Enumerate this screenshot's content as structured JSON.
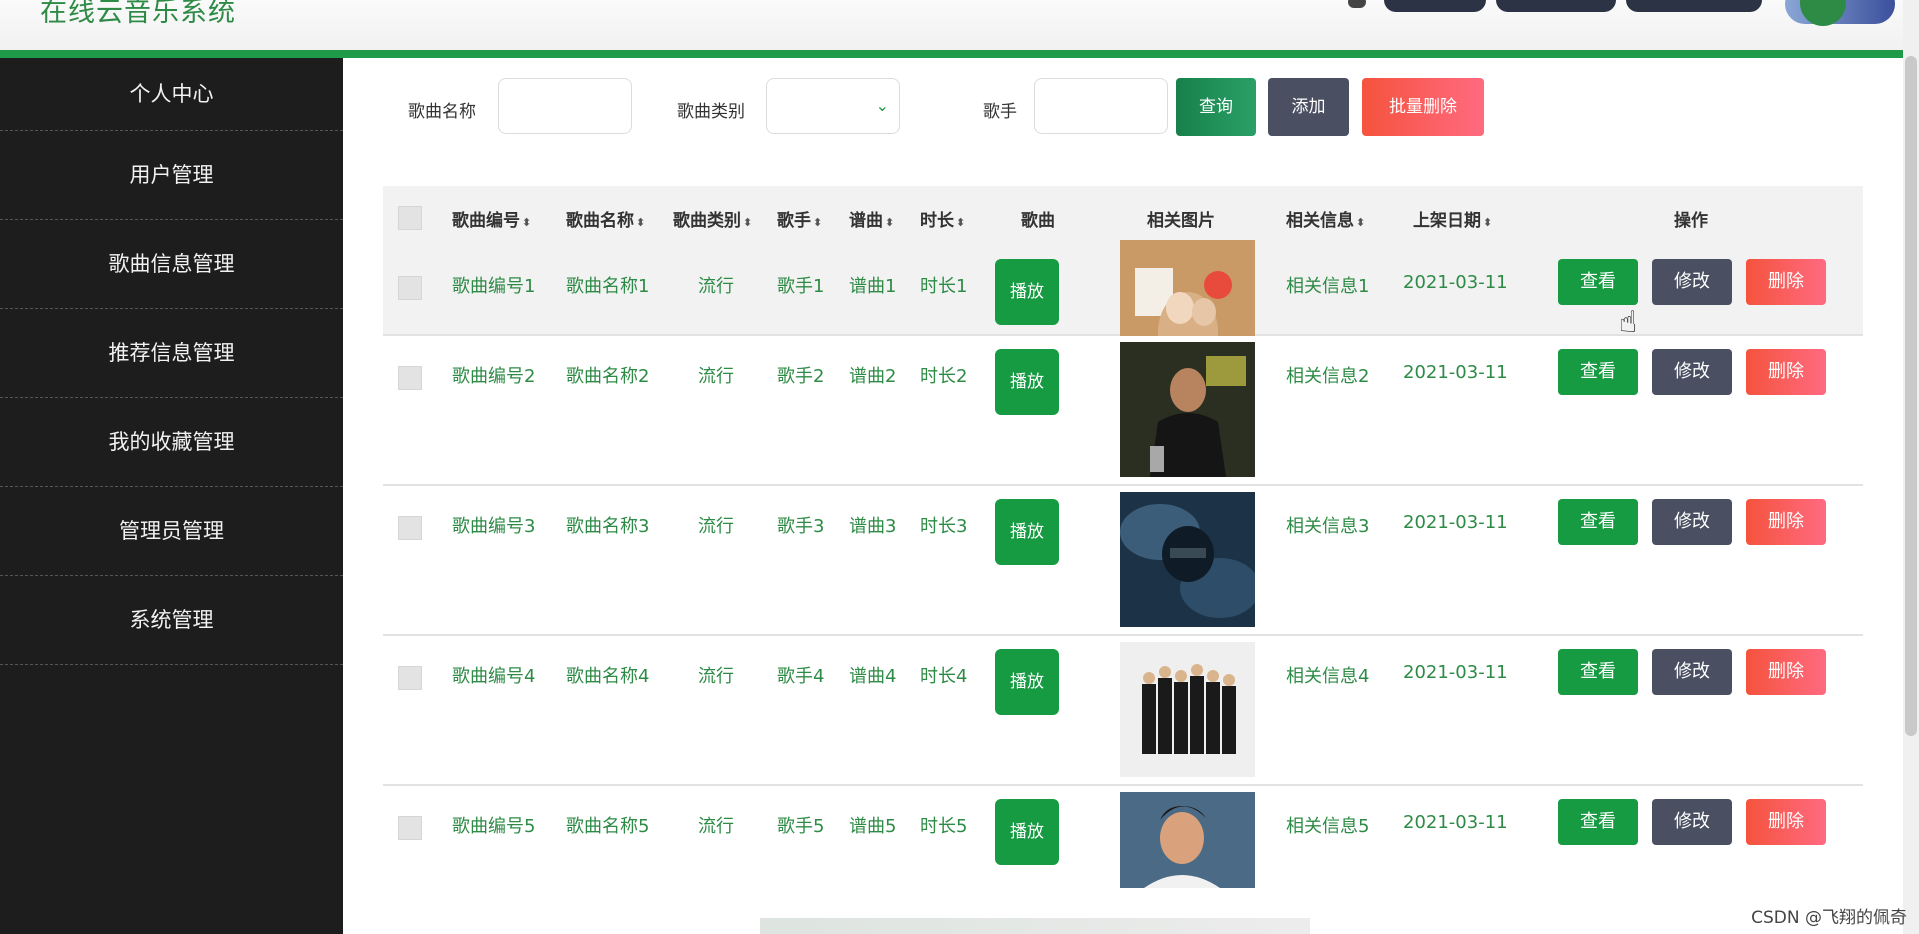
{
  "header": {
    "app_title": "在线云音乐系统"
  },
  "sidebar": {
    "items": [
      {
        "label": "个人中心"
      },
      {
        "label": "用户管理"
      },
      {
        "label": "歌曲信息管理"
      },
      {
        "label": "推荐信息管理"
      },
      {
        "label": "我的收藏管理"
      },
      {
        "label": "管理员管理"
      },
      {
        "label": "系统管理"
      }
    ]
  },
  "search": {
    "song_name_label": "歌曲名称",
    "song_type_label": "歌曲类别",
    "singer_label": "歌手",
    "query_button": "查询",
    "add_button": "添加",
    "batch_delete_button": "批量删除"
  },
  "table": {
    "columns": [
      "歌曲编号",
      "歌曲名称",
      "歌曲类别",
      "歌手",
      "谱曲",
      "时长",
      "歌曲",
      "相关图片",
      "相关信息",
      "上架日期",
      "操作"
    ],
    "sort_icon": "⬍",
    "play_label": "播放",
    "view_label": "查看",
    "edit_label": "修改",
    "delete_label": "删除",
    "rows": [
      {
        "id": "歌曲编号1",
        "name": "歌曲名称1",
        "type": "流行",
        "singer": "歌手1",
        "composer": "谱曲1",
        "duration": "时长1",
        "info": "相关信息1",
        "date": "2021-03-11",
        "image_icon": "photo-icon"
      },
      {
        "id": "歌曲编号2",
        "name": "歌曲名称2",
        "type": "流行",
        "singer": "歌手2",
        "composer": "谱曲2",
        "duration": "时长2",
        "info": "相关信息2",
        "date": "2021-03-11",
        "image_icon": "photo-icon"
      },
      {
        "id": "歌曲编号3",
        "name": "歌曲名称3",
        "type": "流行",
        "singer": "歌手3",
        "composer": "谱曲3",
        "duration": "时长3",
        "info": "相关信息3",
        "date": "2021-03-11",
        "image_icon": "photo-icon"
      },
      {
        "id": "歌曲编号4",
        "name": "歌曲名称4",
        "type": "流行",
        "singer": "歌手4",
        "composer": "谱曲4",
        "duration": "时长4",
        "info": "相关信息4",
        "date": "2021-03-11",
        "image_icon": "photo-icon"
      },
      {
        "id": "歌曲编号5",
        "name": "歌曲名称5",
        "type": "流行",
        "singer": "歌手5",
        "composer": "谱曲5",
        "duration": "时长5",
        "info": "相关信息5",
        "date": "2021-03-11",
        "image_icon": "photo-icon"
      }
    ]
  },
  "watermark": "CSDN @飞翔的佩奇",
  "colors": {
    "accent_green": "#169a42",
    "sidebar_bg": "#1d1d1d",
    "danger": "#f5533d",
    "secondary": "#4a4f62"
  }
}
